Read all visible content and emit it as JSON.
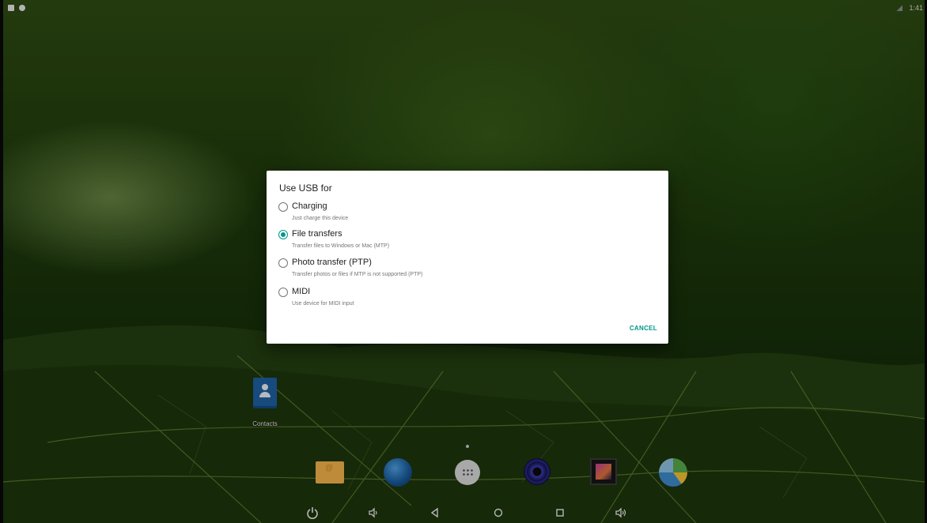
{
  "status_bar": {
    "left_icons": [
      "notification-icon",
      "notification-icon"
    ],
    "right_icons": [
      "signal-icon"
    ],
    "time": "1:41"
  },
  "dialog": {
    "title": "Use USB for",
    "options": [
      {
        "label": "Charging",
        "description": "Just charge this device",
        "selected": false
      },
      {
        "label": "File transfers",
        "description": "Transfer files to Windows or Mac (MTP)",
        "selected": true
      },
      {
        "label": "Photo transfer (PTP)",
        "description": "Transfer photos or files if MTP is not supported (PTP)",
        "selected": false
      },
      {
        "label": "MIDI",
        "description": "Use device for MIDI input",
        "selected": false
      }
    ],
    "cancel_label": "CANCEL",
    "accent_color": "#009688"
  },
  "desktop": {
    "shortcuts": [
      {
        "label": "Contacts",
        "icon": "contacts-icon"
      }
    ]
  },
  "dock": {
    "apps": [
      "email-icon",
      "browser-icon",
      "app-drawer-icon",
      "music-icon",
      "gallery-icon",
      "pie-app-icon"
    ]
  },
  "nav_bar": {
    "buttons": [
      "power-icon",
      "volume-down-icon",
      "back-icon",
      "home-icon",
      "recents-icon",
      "volume-up-icon"
    ]
  }
}
